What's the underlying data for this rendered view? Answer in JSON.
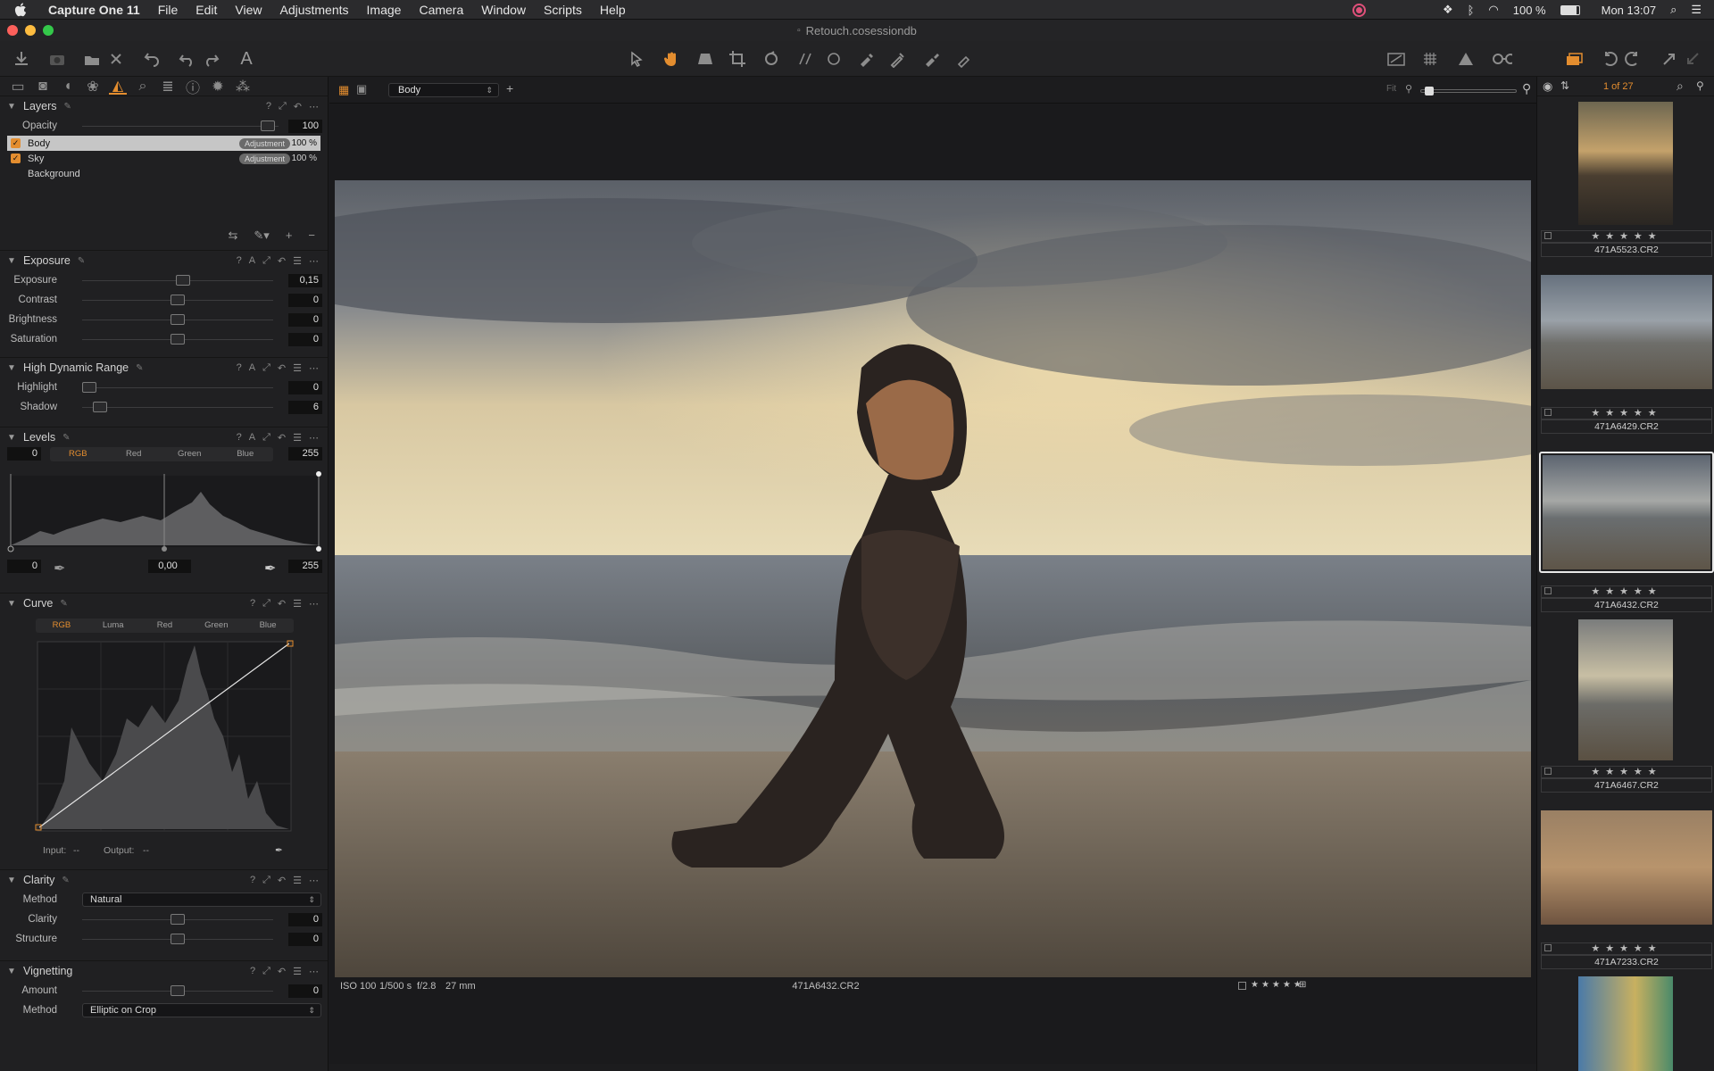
{
  "menubar": {
    "app": "Capture One 11",
    "items": [
      "File",
      "Edit",
      "View",
      "Adjustments",
      "Image",
      "Camera",
      "Window",
      "Scripts",
      "Help"
    ],
    "battery": "100 %",
    "clock": "Mon 13:07"
  },
  "window": {
    "title": "Retouch.cosessiondb"
  },
  "viewbar": {
    "layer_select": "Body",
    "fit_label": "Fit",
    "counter": "1 of 27"
  },
  "layers": {
    "title": "Layers",
    "opacity_label": "Opacity",
    "opacity_value": "100",
    "items": [
      {
        "name": "Body",
        "badge": "Adjustment",
        "pct": "100 %"
      },
      {
        "name": "Sky",
        "badge": "Adjustment",
        "pct": "100 %"
      },
      {
        "name": "Background"
      }
    ]
  },
  "exposure": {
    "title": "Exposure",
    "rows": [
      {
        "label": "Exposure",
        "value": "0,15",
        "level": 0.53
      },
      {
        "label": "Contrast",
        "value": "0",
        "level": 0.5
      },
      {
        "label": "Brightness",
        "value": "0",
        "level": 0.5
      },
      {
        "label": "Saturation",
        "value": "0",
        "level": 0.5
      }
    ]
  },
  "hdr": {
    "title": "High Dynamic Range",
    "rows": [
      {
        "label": "Highlight",
        "value": "0",
        "level": 0.0
      },
      {
        "label": "Shadow",
        "value": "6",
        "level": 0.06
      }
    ]
  },
  "levels": {
    "title": "Levels",
    "tabs": [
      "RGB",
      "Red",
      "Green",
      "Blue"
    ],
    "low_in": "0",
    "high_in": "255",
    "low_out": "0",
    "mid": "0,00",
    "high_out": "255"
  },
  "curve": {
    "title": "Curve",
    "tabs": [
      "RGB",
      "Luma",
      "Red",
      "Green",
      "Blue"
    ],
    "input_label": "Input:",
    "input_value": "--",
    "output_label": "Output:",
    "output_value": "--"
  },
  "clarity": {
    "title": "Clarity",
    "method_label": "Method",
    "method_value": "Natural",
    "rows": [
      {
        "label": "Clarity",
        "value": "0",
        "level": 0.5
      },
      {
        "label": "Structure",
        "value": "0",
        "level": 0.5
      }
    ]
  },
  "vignetting": {
    "title": "Vignetting",
    "amount_label": "Amount",
    "amount_value": "0",
    "amount_level": 0.5,
    "method_label": "Method",
    "method_value": "Elliptic on Crop"
  },
  "infobar": {
    "iso": "ISO 100",
    "shutter": "1/500 s",
    "aperture": "f/2.8",
    "focal": "27 mm",
    "filename": "471A6432.CR2",
    "stars": "★★★★★"
  },
  "browser": {
    "thumbs": [
      {
        "name": "471A5523.CR2",
        "stars": "★★★★★"
      },
      {
        "name": "471A6429.CR2",
        "stars": "★★★★★"
      },
      {
        "name": "471A6432.CR2",
        "stars": "★★★★★"
      },
      {
        "name": "471A6467.CR2",
        "stars": "★★★★★"
      },
      {
        "name": "471A7233.CR2",
        "stars": "★★★★★"
      }
    ]
  },
  "colors": {
    "accent": "#e38d2f",
    "bg": "#1c1c1e",
    "panel": "#202022"
  }
}
